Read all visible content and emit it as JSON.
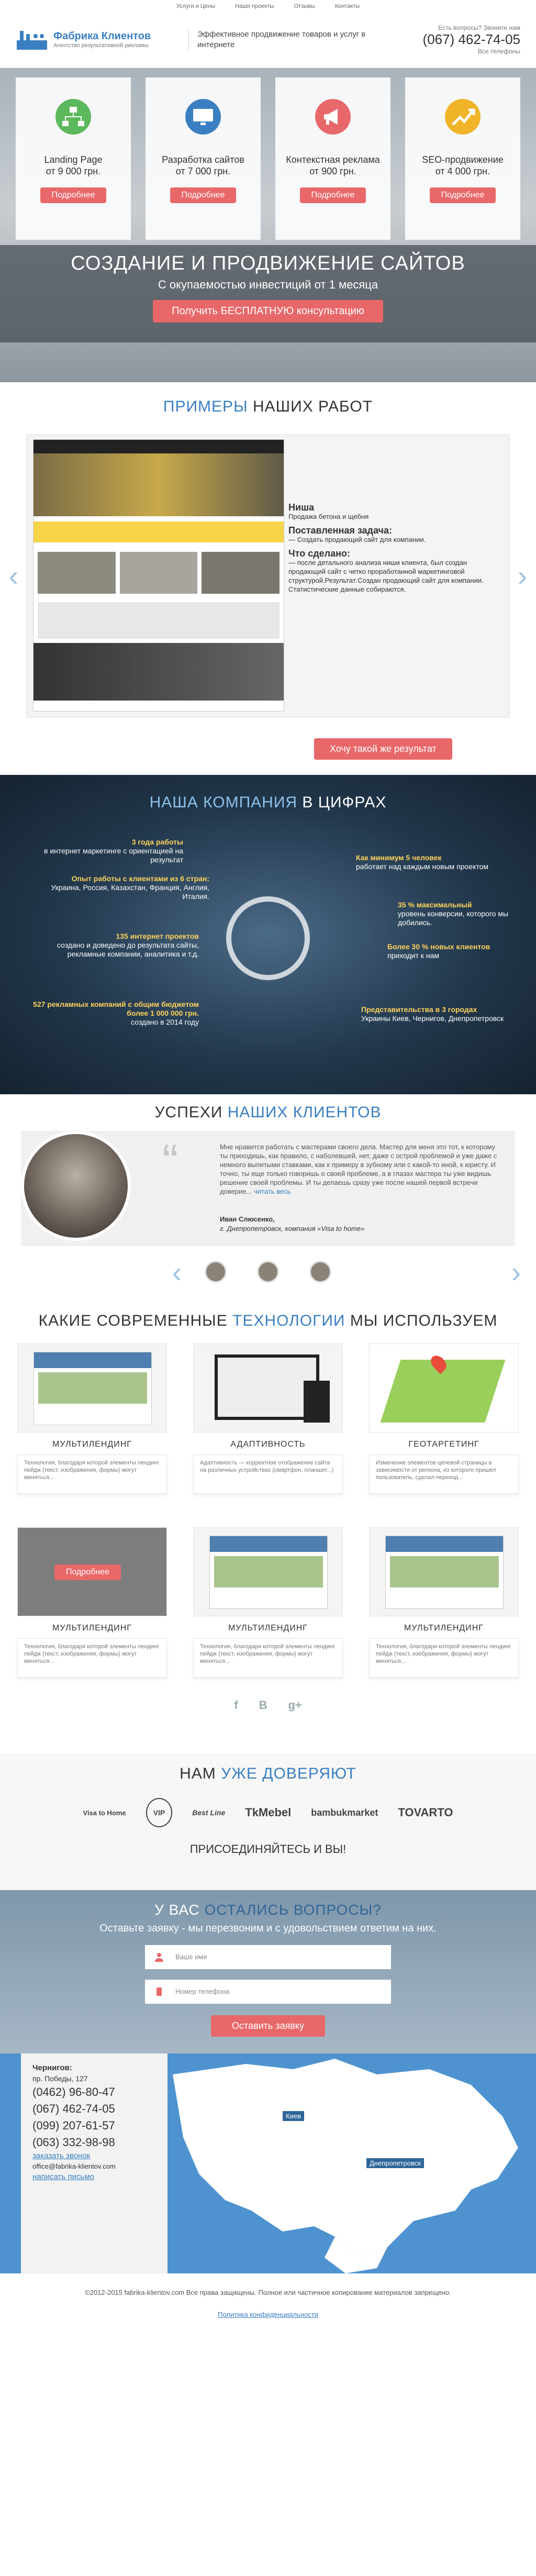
{
  "topnav": [
    "Услуги и Цены",
    "Наши проекты",
    "Отзывы",
    "Контакты"
  ],
  "header": {
    "logo_title": "Фабрика Клиентов",
    "logo_sub": "Агентство результативной рекламы",
    "slogan": "Эффективное продвижение товаров и услуг в интернете",
    "call_question": "Есть вопросы? Звоните нам",
    "phone": "(067) 462-74-05",
    "all_phones": "Все телефоны"
  },
  "services": [
    {
      "title": "Landing Page",
      "price": "от 9 000 грн.",
      "button": "Подробнее",
      "icon": "sitemap-icon",
      "color": "#5cb85c"
    },
    {
      "title": "Разработка сайтов",
      "price": "от 7 000 грн.",
      "button": "Подробнее",
      "icon": "monitor-icon",
      "color": "#3a7fc1"
    },
    {
      "title": "Контекстная реклама",
      "price": "от 900 грн.",
      "button": "Подробнее",
      "icon": "megaphone-icon",
      "color": "#e8686a"
    },
    {
      "title": "SEO-продвижение",
      "price": "от 4 000 грн.",
      "button": "Подробнее",
      "icon": "chart-up-icon",
      "color": "#f0b429"
    }
  ],
  "hero": {
    "title": "СОЗДАНИЕ И ПРОДВИЖЕНИЕ САЙТОВ",
    "subtitle": "С окупаемостью инвестиций от 1 месяца",
    "button": "Получить БЕСПЛАТНУЮ консультацию"
  },
  "examples": {
    "title_hl": "ПРИМЕРЫ",
    "title_rest": "НАШИХ РАБОТ",
    "niche_label": "Ниша",
    "niche": "Продажа бетона и щебня",
    "task_label": "Поставленная задача:",
    "task": "— Создать продающий сайт для компании.",
    "done_label": "Что сделано:",
    "done": "— после детального анализа ниши клиента, был создан продающий сайт с четко проработанной маркетинговой структурой.Результат:Создан продающий сайт для компании. Статистические данные собираются.",
    "button": "Хочу такой же результат"
  },
  "numbers": {
    "title_rest": "НАША КОМПАНИЯ",
    "title_hl": "В ЦИФРАХ",
    "items": [
      {
        "hl": "3 года работы",
        "text": "в интернет маркетинге с ориентацией на результат"
      },
      {
        "hl": "Опыт работы с клиентами из 6 стран:",
        "text": "Украина, Россия, Казахстан, Франция, Англия, Италия."
      },
      {
        "hl": "135 интернет проектов",
        "text": "создано и доведено до результата сайты, рекламные компании, аналитика и т.д."
      },
      {
        "hl": "527 рекламных компаний с общим бюджетом более 1 000 000 грн.",
        "text": "создано в 2014 году"
      },
      {
        "hl": "Как минимум 5 человек",
        "text": "работает над каждым новым проектом"
      },
      {
        "hl": "35 % максимальный",
        "text": "уровень конверсии, которого мы добились."
      },
      {
        "hl": "Более 30 % новых клиентов",
        "text": "приходит к нам"
      },
      {
        "hl": "Представительства в 3 городах",
        "text": "Украины Киев, Чернигов, Днепропетровск"
      }
    ]
  },
  "testimonials": {
    "title_rest": "УСПЕХИ",
    "title_hl": "НАШИХ КЛИЕНТОВ",
    "text": "Мне нравится работать с мастерами своего дела. Мастер для меня это тот, к которому ты приходишь, как правило, с наболевшей, нет, даже с острой проблемой и уже даже с немного выпитыми ставками, как к примеру в зубному или с какой-то иной, к юристу. И точно, ты еще только говоришь о своей проблеме, а в глазах мастера ты уже видишь решение своей проблемы. И ты делаешь сразу уже после нашей первой встречи доверие... ",
    "more": "читать весь",
    "author": "Иван Слюсенко,",
    "company": "г. Днепропетровск, компания «Visa to home»"
  },
  "tech": {
    "title_rest": "КАКИЕ СОВРЕМЕННЫЕ",
    "title_hl": "ТЕХНОЛОГИИ",
    "title_end": "МЫ ИСПОЛЬЗУЕМ",
    "items": [
      {
        "name": "МУЛЬТИЛЕНДИНГ",
        "desc": "Технология, благодаря которой элементы лендинг пейдж (текст, изображения, формы) могут меняться... "
      },
      {
        "name": "АДАПТИВНОСТЬ",
        "desc": "Адаптивность — корректное отображение сайта на различных устройствах (смартфон, планшет...)"
      },
      {
        "name": "ГЕОТАРГЕТИНГ",
        "desc": "Изменение элементов целевой страницы в зависимости от региона, из которого пришел пользователь, сделал переход..."
      },
      {
        "name": "МУЛЬТИЛЕНДИНГ",
        "desc": "Технология, благодаря которой элементы лендинг пейдж (текст, изображения, формы) могут меняться... ",
        "hover": "Подробнее"
      },
      {
        "name": "МУЛЬТИЛЕНДИНГ",
        "desc": "Технология, благодаря которой элементы лендинг пейдж (текст, изображения, формы) могут меняться..."
      },
      {
        "name": "МУЛЬТИЛЕНДИНГ",
        "desc": "Технология, благодаря которой элементы лендинг пейдж (текст, изображения, формы) могут меняться..."
      }
    ],
    "social": [
      "f",
      "B",
      "g+"
    ]
  },
  "trust": {
    "title_rest": "НАМ",
    "title_hl": "УЖЕ ДОВЕРЯЮТ",
    "logos": [
      "Visa to Home",
      "VIP",
      "Best Line",
      "TkMebel",
      "bambukmarket",
      "TOVARTO"
    ],
    "join": "ПРИСОЕДИНЯЙТЕСЬ И ВЫ!"
  },
  "form": {
    "title_rest": "У ВАС",
    "title_hl": "ОСТАЛИСЬ ВОПРОСЫ?",
    "subtitle": "Оставьте заявку - мы перезвоним и с удовольствием ответим на них.",
    "name_placeholder": "Ваше имя",
    "phone_placeholder": "Номер телефона",
    "button": "Оставить заявку"
  },
  "contact": {
    "city": "Чернигов:",
    "address": "пр. Победы, 127",
    "phones": [
      "(0462) 96-80-47",
      "(067) 462-74-05",
      "(099) 207-61-57",
      "(063) 332-98-98"
    ],
    "order_call": "заказать звонок",
    "email": "office@fabrika-klientov.com",
    "write": "написать письмо",
    "map_labels": [
      "Киев",
      "Днепропетровск"
    ]
  },
  "footer": {
    "copy": "©2012-2015 fabrika-klientov.com Все права защищены. Полное или частичное копирование материалов запрещено.",
    "policy": "Политика конфиденциальности"
  }
}
